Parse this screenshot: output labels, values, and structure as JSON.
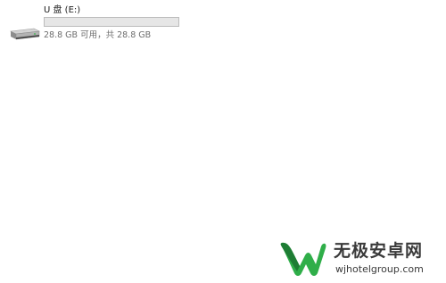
{
  "drive": {
    "name": "U 盘 (E:)",
    "space_text": "28.8 GB 可用，共 28.8 GB",
    "used_fraction": 0.0,
    "icon": "usb-drive-icon"
  },
  "watermark": {
    "title": "无极安卓网",
    "url": "wjhotelgroup.com",
    "logo_icon": "w-logo-icon",
    "colors": {
      "logo_green": "#2fae49",
      "logo_dark_green": "#1e7d34",
      "text": "#3a3a3a"
    }
  }
}
